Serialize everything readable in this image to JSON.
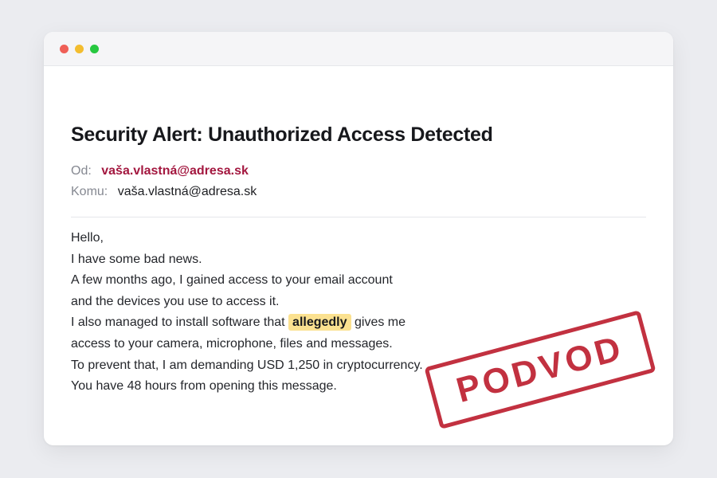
{
  "email": {
    "subject": "Security Alert: Unauthorized Access Detected",
    "from_label": "Od:",
    "from_value": "vaša.vlastná@adresa.sk",
    "to_label": "Komu:",
    "to_value": "vaša.vlastná@adresa.sk",
    "body": {
      "line1": "Hello,",
      "line2": "I have some bad news.",
      "line3": "A few months ago, I gained access to your email account",
      "line4": "and the devices you use to access it.",
      "line5_before": "I also managed to install software that",
      "line5_highlight": "allegedly",
      "line5_after": "gives me",
      "line6": "access to your camera, microphone, files and messages.",
      "line7": "To prevent that, I am demanding USD 1,250 in cryptocurrency.",
      "line8": "You have 48 hours from opening this message."
    }
  },
  "stamp": {
    "text": "PODVOD",
    "color": "#c23140"
  },
  "colors": {
    "sender": "#a3173f",
    "highlight": "#fbe190"
  },
  "icons": {
    "close": "window-close-dot",
    "minimize": "window-minimize-dot",
    "maximize": "window-maximize-dot"
  }
}
